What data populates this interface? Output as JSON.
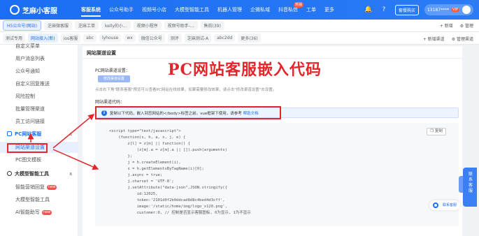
{
  "app": {
    "logo_text": "芝麻小客服"
  },
  "top_nav": {
    "items": [
      {
        "label": "客服系统",
        "active": true
      },
      {
        "label": "公众号助手"
      },
      {
        "label": "视频号小店"
      },
      {
        "label": "大模型智能工具"
      },
      {
        "label": "机器人管理"
      },
      {
        "label": "企微私域"
      },
      {
        "label": "抖音私信",
        "badge": "热销"
      },
      {
        "label": "工单"
      },
      {
        "label": "更多"
      }
    ],
    "purchase_label": "套餐购买",
    "user_label": "13187****",
    "vip_label": "VIP"
  },
  "tabs": {
    "items": [
      "H5公众号(网站)",
      "芝麻微客服",
      "芝麻工单",
      "kelly的小...",
      "视频小程序",
      "视频号助手-...",
      "售前(39)"
    ],
    "right_tools": [
      "新增",
      "管理"
    ]
  },
  "channels": {
    "items": [
      "测试专用",
      "网站接入(新)",
      "ios客服",
      "abc",
      "lyhouse",
      "wx",
      "微信公众号",
      "测评",
      "芝麻测试-A",
      "abc2dd"
    ],
    "more_label": "更多(36)",
    "add_label": "新增渠道",
    "manage_label": "管理渠道"
  },
  "sidebar": {
    "items_top": [
      "自定义菜单",
      "用户消息列表",
      "公众号通知",
      "自定义回复推送",
      "风险控制",
      "批量管理渠道",
      "员工访问链接"
    ],
    "group_pc": "PC网站客服",
    "group_pc_items": [
      "网站渠道设置",
      "PC图文模板"
    ],
    "group_ai": "大模型智能工具",
    "group_ai_items": [
      {
        "label": "智能营销回复",
        "badge": "new"
      },
      {
        "label": "大模型智能工具"
      },
      {
        "label": "AI智能助写",
        "badge": "new"
      }
    ]
  },
  "main": {
    "card_title": "网站渠道设置",
    "big_title": "PC网站客服嵌入代码",
    "pc_label": "PC网站渠道设置：",
    "modify_button": "修改渠道设置",
    "desc": "点击右下角\"联系客服\"预览可以查看PC网站在线效果，如果需要修改效果，请点击\"修改渠道设置\"去设置。",
    "code_label": "网站渠道代码：",
    "notice_text": "复制以下代码，嵌入到您网站的</body>标签之前。vue框架下使用，请参考",
    "notice_link": "帮助文档",
    "copy_button": "复制",
    "chat_pill_label": "联系客服",
    "code_lines": [
      "<script type=\"text/javascript\">",
      "    (function(s, h, a, x, j, e) {",
      "        z[l] = z[m] || function() {",
      "            (z[m].a = z[m].a || []).push(arguments)",
      "        };",
      "        j = h.createElement(i),",
      "        s = h.getElementsByTagName(i)[0];",
      "        j.async = true;",
      "        j.charset = 'UTF-8';",
      "        j.setAttribute(\"data-json\",JSON.stringify({",
      "            id:12025,",
      "            token:'2101d0f2b0ddcad8d8c4bed4d3cff',",
      "            image:'/static/home/img/logo_x120.png',",
      "            customer:0, // 控制是否显示客服图标, 0为显示, 1为不显示"
    ]
  },
  "float_panel": {
    "label": "联系客服"
  },
  "colors": {
    "brand": "#1b6ef3",
    "annotation_red": "#e3262c"
  }
}
